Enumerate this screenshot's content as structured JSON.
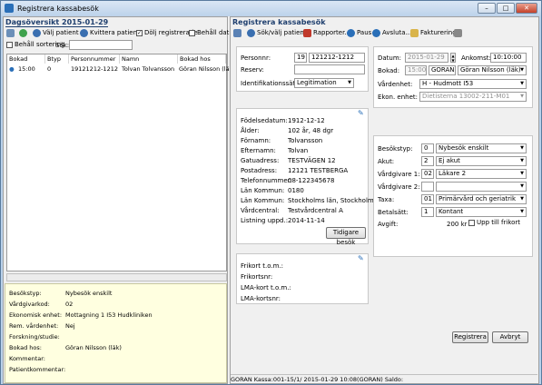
{
  "window": {
    "title": "Registrera kassabesök",
    "buttons": {
      "minimize": "–",
      "maximize": "□",
      "close": "✕"
    }
  },
  "left": {
    "title": "Dagsöversikt 2015-01-29",
    "toolbar": {
      "select_patient": "Välj patient",
      "receipt_patient": "Kvittera patient",
      "hide_registered": "Dölj registrerade",
      "keep_date": "Behåll datum",
      "keep_sort": "Behåll sortering",
      "search_label": "Sök:"
    },
    "columns": [
      "Bokad",
      "Btyp",
      "Personnummer",
      "Namn",
      "Bokad hos"
    ],
    "rows": [
      {
        "bokad": "15:00",
        "btyp": "0",
        "personnummer": "19121212-1212",
        "namn": "Tolvan Tolvansson",
        "bokad_hos": "Göran Nilsson (läk)"
      }
    ],
    "info": [
      {
        "label": "Besökstyp:",
        "value": "Nybesök enskilt"
      },
      {
        "label": "Vårdgivarkod:",
        "value": "02"
      },
      {
        "label": "Ekonomisk enhet:",
        "value": "Mottagning 1 I53 Hudkliniken"
      },
      {
        "label": "Rem. vårdenhet:",
        "value": "Nej"
      },
      {
        "label": "Forskning/studie:",
        "value": ""
      },
      {
        "label": "Bokad hos:",
        "value": "Göran Nilsson (läk)"
      },
      {
        "label": "Kommentar:",
        "value": ""
      },
      {
        "label": "Patientkommentar:",
        "value": ""
      }
    ]
  },
  "right": {
    "title": "Registrera kassabesök",
    "toolbar": {
      "search_patient": "Sök/välj patient",
      "reports": "Rapporter...",
      "pause": "Paus",
      "close_day": "Avsluta...",
      "invoicing": "Fakturering"
    },
    "patient": {
      "personnr_label": "Personnr:",
      "century": "19",
      "personnr": "121212-1212",
      "reserv_label": "Reserv:",
      "reserv": "",
      "id_method_label": "Identifikationssätt:",
      "id_method": "Legitimation"
    },
    "details": [
      {
        "label": "Födelsedatum:",
        "value": "1912-12-12"
      },
      {
        "label": "Ålder:",
        "value": "102 år, 48 dgr"
      },
      {
        "label": "Förnamn:",
        "value": "Tolvansson"
      },
      {
        "label": "Efternamn:",
        "value": "Tolvan"
      },
      {
        "label": "Gatuadress:",
        "value": "TESTVÄGEN 12"
      },
      {
        "label": "Postadress:",
        "value": "12121      TESTBERGA"
      },
      {
        "label": "Telefonnummer:",
        "value": "08-122345678"
      },
      {
        "label": "Län Kommun:",
        "value": "0180"
      },
      {
        "label": "Län Kommun:",
        "value": "Stockholms län, Stockholm"
      },
      {
        "label": "Vårdcentral:",
        "value": "Testvårdcentral A"
      },
      {
        "label": "Listning uppd.:",
        "value": "2014-11-14"
      }
    ],
    "earlier_visits_button": "Tidigare besök",
    "free_card": [
      {
        "label": "Frikort t.o.m.:",
        "value": ""
      },
      {
        "label": "Frikortsnr:",
        "value": ""
      },
      {
        "label": "LMA-kort t.o.m.:",
        "value": ""
      },
      {
        "label": "LMA-kortsnr:",
        "value": ""
      }
    ],
    "visit": {
      "date_label": "Datum:",
      "date": "2015-01-29",
      "arrival_label": "Ankomst:",
      "arrival": "10:10:00",
      "booked_label": "Bokad:",
      "booked_time": "15:00",
      "booked_code": "GORAN",
      "booked_name": "Göran Nilsson (läk)",
      "unit_label": "Vårdenhet:",
      "unit": "H - Hudmott I53",
      "econ_label": "Ekon. enhet:",
      "econ": "Dietisterna  13002-211-M01"
    },
    "billing": [
      {
        "label": "Besökstyp:",
        "code": "0",
        "value": "Nybesök enskilt"
      },
      {
        "label": "Akut:",
        "code": "2",
        "value": "Ej akut"
      },
      {
        "label": "Vårdgivare 1:",
        "code": "02",
        "value": "Läkare 2"
      },
      {
        "label": "Vårdgivare 2:",
        "code": "",
        "value": ""
      },
      {
        "label": "Taxa:",
        "code": "01",
        "value": "Primärvård och geriatrik"
      },
      {
        "label": "Betalsätt:",
        "code": "1",
        "value": "Kontant"
      }
    ],
    "fee_label": "Avgift:",
    "fee": "200 kr",
    "fee_checkbox": "Upp till frikort",
    "register_button": "Registrera",
    "cancel_button": "Avbryt",
    "status": "GORAN  Kassa:001-15/1/  2015-01-29 10:08(GORAN)  Saldo:"
  }
}
